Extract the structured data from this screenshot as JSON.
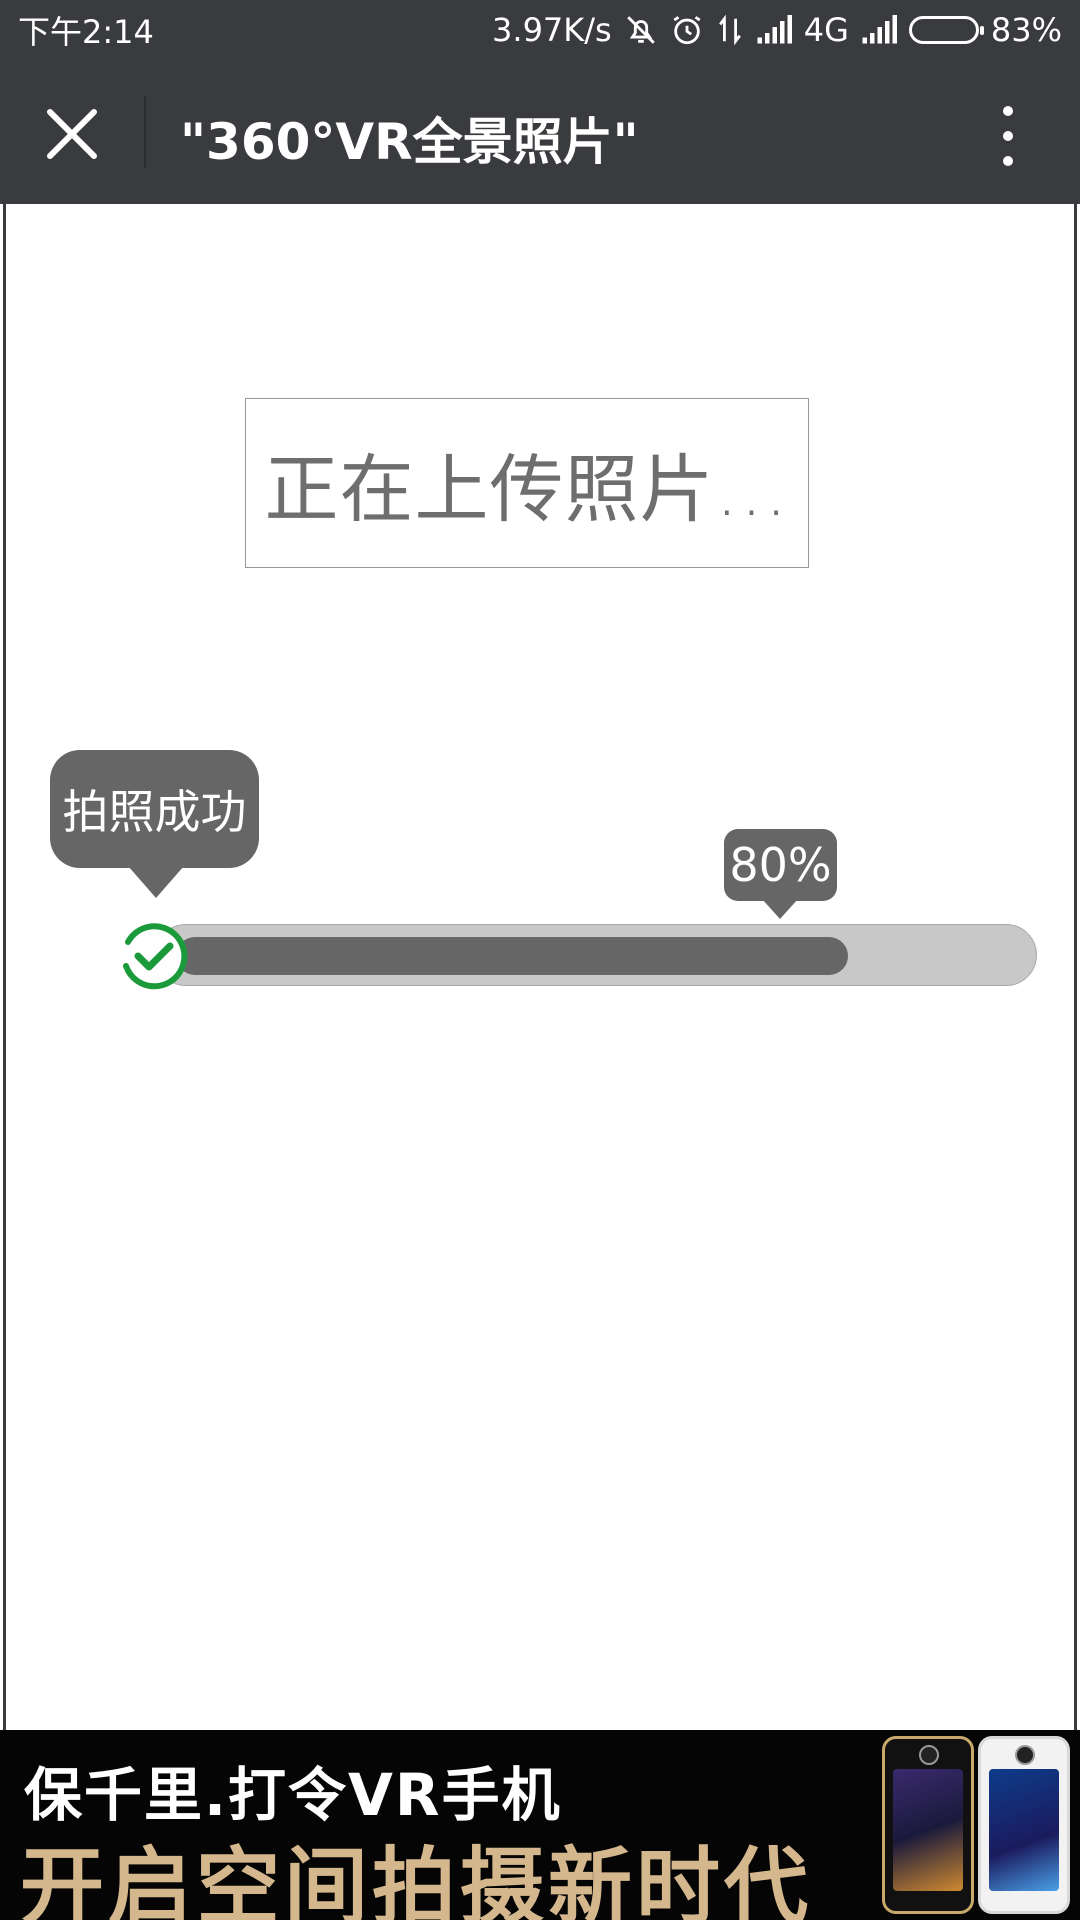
{
  "status_bar": {
    "time": "下午2:14",
    "net_speed": "3.97K/s",
    "network_type": "4G",
    "battery_level": 0.83,
    "battery_percent": "83%",
    "icons": [
      "mute-icon",
      "alarm-icon",
      "data-transfer-icon",
      "signal-icon",
      "signal-icon",
      "battery-icon"
    ]
  },
  "title_bar": {
    "title": "\"360°VR全景照片\"",
    "icons": [
      "close-icon",
      "more-vertical-icon"
    ]
  },
  "main": {
    "status_text": "正在上传照片…",
    "success_tooltip": "拍照成功",
    "progress_label": "80%",
    "progress_value": 0.8,
    "check_icon_color": "#1a9a3a"
  },
  "ad": {
    "line1": "保千里.打令VR手机",
    "line2": "开启空间拍摄新时代",
    "line2_color": "#d4b78d"
  }
}
